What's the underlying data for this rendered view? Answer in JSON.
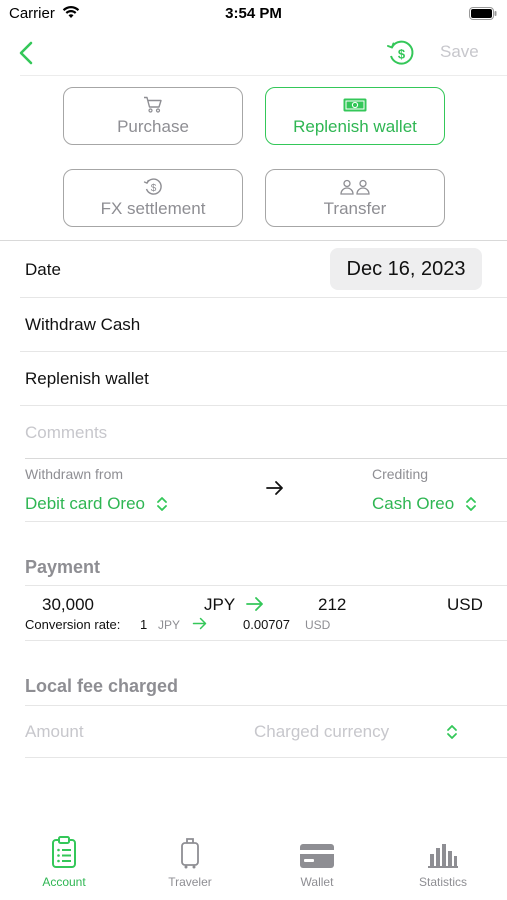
{
  "status_bar": {
    "carrier": "Carrier",
    "time": "3:54 PM"
  },
  "nav": {
    "save_label": "Save"
  },
  "transaction_types": [
    {
      "label": "Purchase",
      "icon": "cart-icon",
      "selected": false
    },
    {
      "label": "Replenish wallet",
      "icon": "banknote-icon",
      "selected": true
    },
    {
      "label": "FX settlement",
      "icon": "currency-exchange-icon",
      "selected": false
    },
    {
      "label": "Transfer",
      "icon": "people-icon",
      "selected": false
    }
  ],
  "date": {
    "label": "Date",
    "value": "Dec 16, 2023"
  },
  "title_field": {
    "value": "Withdraw Cash"
  },
  "category_field": {
    "value": "Replenish wallet"
  },
  "comments": {
    "placeholder": "Comments"
  },
  "accounts": {
    "from_label": "Withdrawn from",
    "from_value": "Debit card Oreo",
    "to_label": "Crediting",
    "to_value": "Cash Oreo"
  },
  "payment": {
    "title": "Payment",
    "amount": "30,000",
    "from_currency": "JPY",
    "converted_amount": "212",
    "to_currency": "USD",
    "rate_label": "Conversion rate:",
    "rate_from_value": "1",
    "rate_from_currency": "JPY",
    "rate_to_value": "0.00707",
    "rate_to_currency": "USD"
  },
  "local_fee": {
    "title": "Local fee charged",
    "amount_placeholder": "Amount",
    "currency_placeholder": "Charged currency"
  },
  "tabs": [
    {
      "label": "Account",
      "icon": "clipboard-icon",
      "active": true
    },
    {
      "label": "Traveler",
      "icon": "luggage-icon",
      "active": false
    },
    {
      "label": "Wallet",
      "icon": "wallet-icon",
      "active": false
    },
    {
      "label": "Statistics",
      "icon": "bar-chart-icon",
      "active": false
    }
  ],
  "colors": {
    "accent": "#34c759",
    "accent_text": "#2fb653",
    "secondary": "#8e8e93",
    "placeholder": "#c7c7cc"
  }
}
